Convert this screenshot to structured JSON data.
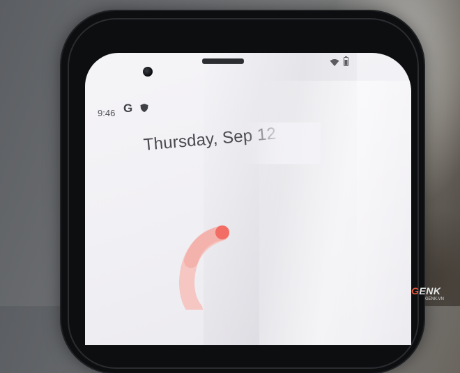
{
  "status_bar": {
    "time": "9:46",
    "google_icon_glyph": "G",
    "icons": [
      "google-icon",
      "shield-icon",
      "wifi-icon",
      "battery-icon"
    ]
  },
  "lock_screen": {
    "date": "Thursday, Sep 12"
  },
  "watermark": {
    "brand": "GENK",
    "brand_first_letter": "G",
    "brand_rest": "ENK",
    "site": "GENK.VN"
  },
  "colors": {
    "screen": "#f2f1f5",
    "arc_accent": "#f26d64",
    "arc_faint": "#f5c6c2",
    "phone_body": "#0d0e10",
    "side_button": "#c1443c"
  }
}
